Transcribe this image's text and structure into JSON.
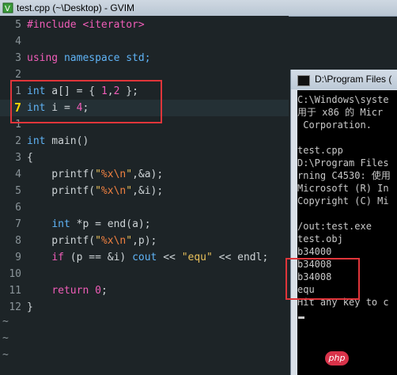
{
  "window": {
    "title": "test.cpp (~\\Desktop) - GVIM"
  },
  "editor": {
    "lines": [
      {
        "num": "5",
        "parts": [
          {
            "t": "#include <iterator>",
            "c": "kw2"
          }
        ]
      },
      {
        "num": "4",
        "parts": []
      },
      {
        "num": "3",
        "parts": [
          {
            "t": "using",
            "c": "kw2"
          },
          {
            "t": " namespace ",
            "c": "kw"
          },
          {
            "t": "std;",
            "c": "kw"
          }
        ]
      },
      {
        "num": "2",
        "parts": []
      },
      {
        "num": "1",
        "parts": [
          {
            "t": "int",
            "c": "kw"
          },
          {
            "t": " a[] = { ",
            "c": ""
          },
          {
            "t": "1",
            "c": "num"
          },
          {
            "t": ",",
            "c": ""
          },
          {
            "t": "2",
            "c": "num"
          },
          {
            "t": " };",
            "c": ""
          }
        ]
      },
      {
        "num": "7",
        "current": true,
        "parts": [
          {
            "t": "int",
            "c": "kw"
          },
          {
            "t": " i = ",
            "c": ""
          },
          {
            "t": "4",
            "c": "num"
          },
          {
            "t": ";",
            "c": ""
          }
        ]
      },
      {
        "num": "1",
        "parts": []
      },
      {
        "num": "2",
        "parts": [
          {
            "t": "int",
            "c": "kw"
          },
          {
            "t": " main()",
            "c": ""
          }
        ]
      },
      {
        "num": "3",
        "parts": [
          {
            "t": "{",
            "c": ""
          }
        ]
      },
      {
        "num": "4",
        "parts": [
          {
            "t": "    printf(",
            "c": ""
          },
          {
            "t": "\"",
            "c": "str"
          },
          {
            "t": "%x\\n",
            "c": "fmt"
          },
          {
            "t": "\"",
            "c": "str"
          },
          {
            "t": ",&a);",
            "c": ""
          }
        ]
      },
      {
        "num": "5",
        "parts": [
          {
            "t": "    printf(",
            "c": ""
          },
          {
            "t": "\"",
            "c": "str"
          },
          {
            "t": "%x\\n",
            "c": "fmt"
          },
          {
            "t": "\"",
            "c": "str"
          },
          {
            "t": ",&i);",
            "c": ""
          }
        ]
      },
      {
        "num": "6",
        "parts": []
      },
      {
        "num": "7",
        "parts": [
          {
            "t": "    ",
            "c": ""
          },
          {
            "t": "int",
            "c": "kw"
          },
          {
            "t": " *p = end(a);",
            "c": ""
          }
        ]
      },
      {
        "num": "8",
        "parts": [
          {
            "t": "    printf(",
            "c": ""
          },
          {
            "t": "\"",
            "c": "str"
          },
          {
            "t": "%x\\n",
            "c": "fmt"
          },
          {
            "t": "\"",
            "c": "str"
          },
          {
            "t": ",p);",
            "c": ""
          }
        ]
      },
      {
        "num": "9",
        "parts": [
          {
            "t": "    ",
            "c": ""
          },
          {
            "t": "if",
            "c": "kw2"
          },
          {
            "t": " (p == &i) ",
            "c": ""
          },
          {
            "t": "cout",
            "c": "kw"
          },
          {
            "t": " << ",
            "c": ""
          },
          {
            "t": "\"equ\"",
            "c": "str"
          },
          {
            "t": " << endl;",
            "c": ""
          }
        ]
      },
      {
        "num": "10",
        "parts": []
      },
      {
        "num": "11",
        "parts": [
          {
            "t": "    ",
            "c": ""
          },
          {
            "t": "return",
            "c": "kw2"
          },
          {
            "t": " ",
            "c": ""
          },
          {
            "t": "0",
            "c": "num"
          },
          {
            "t": ";",
            "c": ""
          }
        ]
      },
      {
        "num": "12",
        "parts": [
          {
            "t": "}",
            "c": ""
          }
        ]
      }
    ],
    "tildes": [
      "~",
      "~",
      "~"
    ]
  },
  "console": {
    "title": "D:\\Program Files (",
    "lines": [
      "C:\\Windows\\syste",
      "用于 x86 的 Micr",
      " Corporation.",
      "",
      "test.cpp",
      "D:\\Program Files",
      "rning C4530: 使用",
      "Microsoft (R) In",
      "Copyright (C) Mi",
      "",
      "/out:test.exe",
      "test.obj",
      "b34000",
      "b34008",
      "b34008",
      "equ",
      "Hit any key to c"
    ]
  },
  "watermark": "php"
}
